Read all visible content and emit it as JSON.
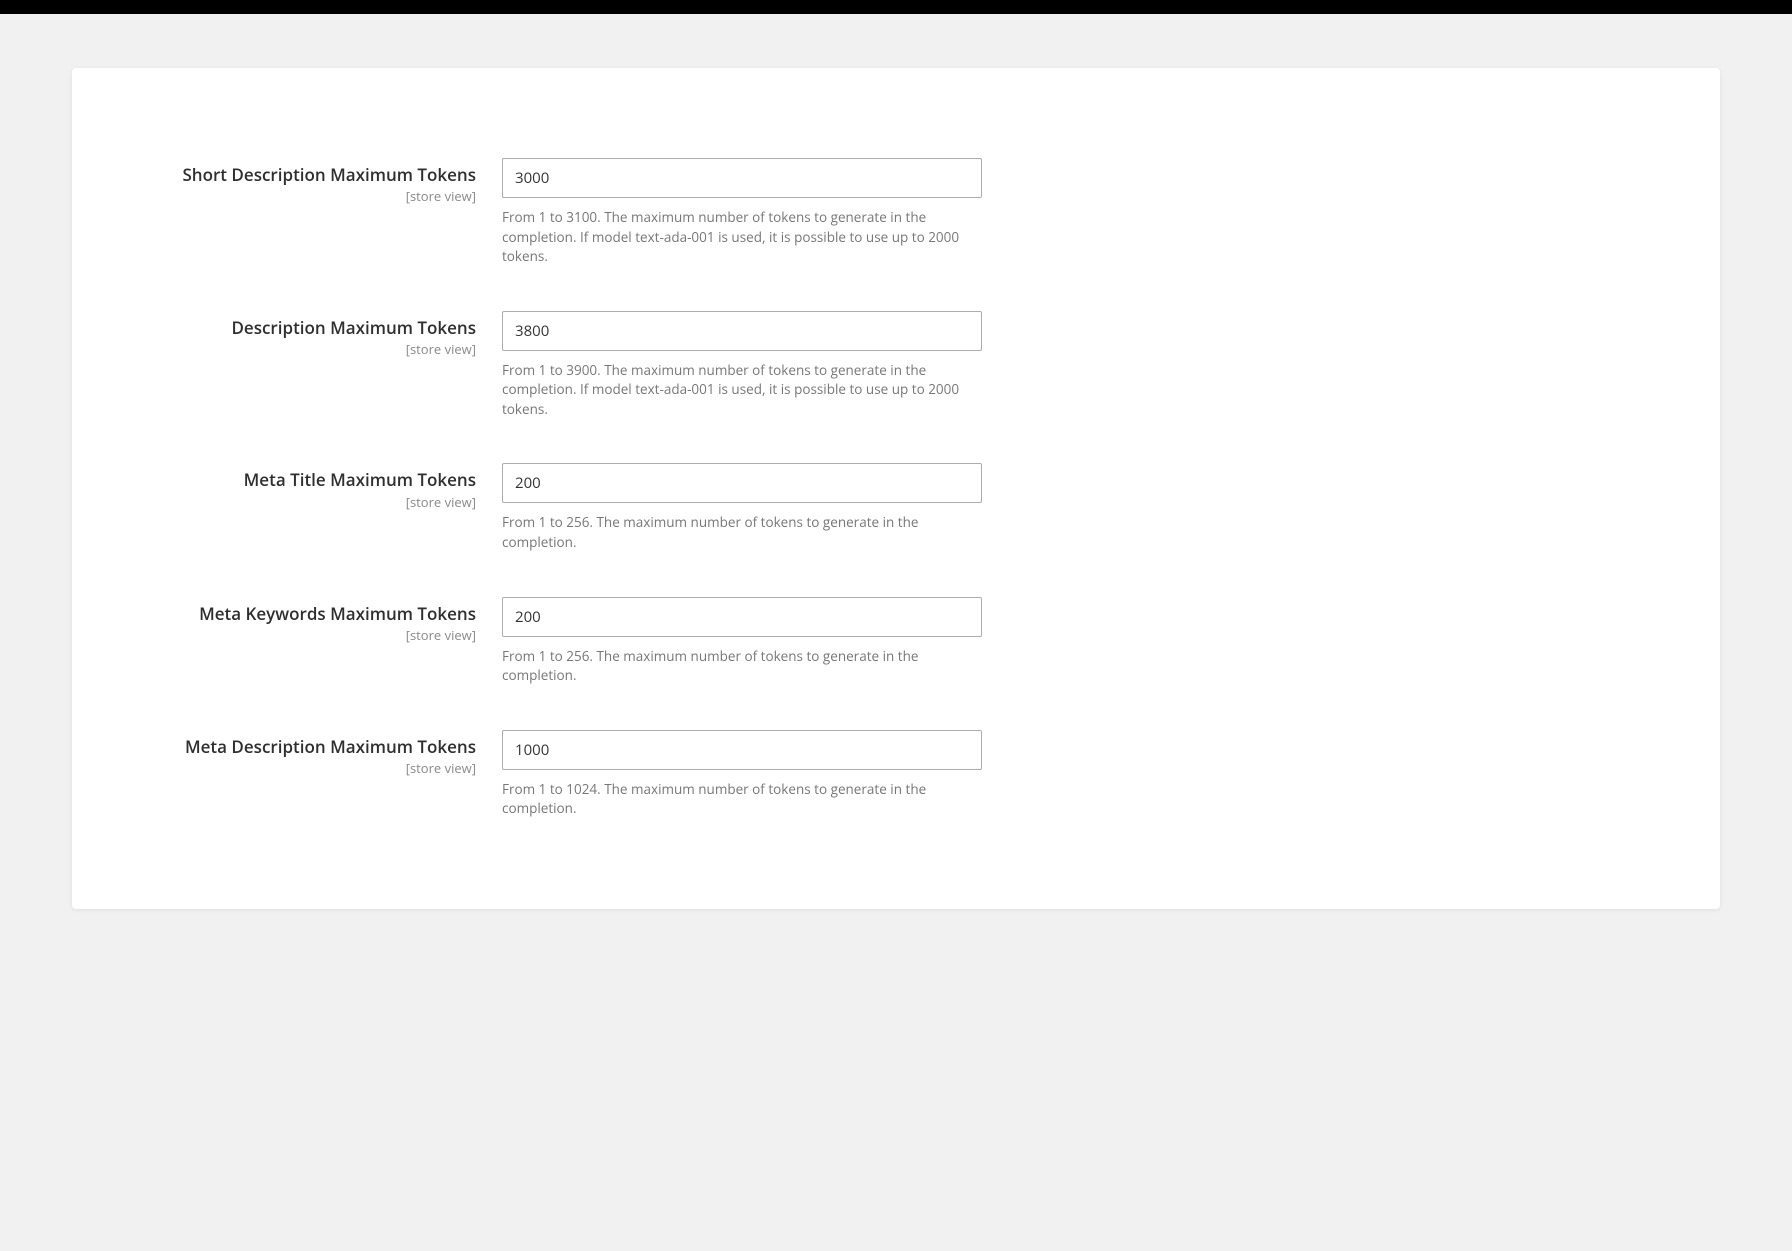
{
  "scope_label": "[store view]",
  "fields": {
    "short_desc": {
      "label": "Short Description Maximum Tokens",
      "value": "3000",
      "help": "From 1 to 3100. The maximum number of tokens to generate in the completion. If model text-ada-001 is used, it is possible to use up to 2000 tokens."
    },
    "desc": {
      "label": "Description Maximum Tokens",
      "value": "3800",
      "help": "From 1 to 3900. The maximum number of tokens to generate in the completion. If model text-ada-001 is used, it is possible to use up to 2000 tokens."
    },
    "meta_title": {
      "label": "Meta Title Maximum Tokens",
      "value": "200",
      "help": "From 1 to 256. The maximum number of tokens to generate in the completion."
    },
    "meta_keywords": {
      "label": "Meta Keywords Maximum Tokens",
      "value": "200",
      "help": "From 1 to 256. The maximum number of tokens to generate in the completion."
    },
    "meta_desc": {
      "label": "Meta Description Maximum Tokens",
      "value": "1000",
      "help": "From 1 to 1024. The maximum number of tokens to generate in the completion."
    }
  }
}
